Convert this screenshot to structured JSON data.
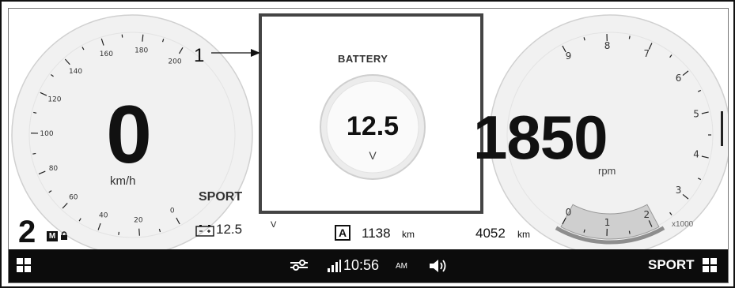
{
  "callout": {
    "number": "1"
  },
  "battery": {
    "title": "BATTERY",
    "value": "12.5",
    "unit": "V"
  },
  "speedometer": {
    "value": "0",
    "unit": "km/h",
    "ticks": [
      "0",
      "20",
      "40",
      "60",
      "80",
      "100",
      "120",
      "140",
      "160",
      "180",
      "200"
    ]
  },
  "tachometer": {
    "value": "1850",
    "unit": "rpm",
    "multiplier": "x1000",
    "ticks": [
      "0",
      "1",
      "2",
      "3",
      "4",
      "5",
      "6",
      "7",
      "8",
      "9"
    ]
  },
  "riding_mode": {
    "label": "SPORT"
  },
  "gear": {
    "number": "2",
    "mode": "M"
  },
  "status": {
    "battery_value": "12.5",
    "battery_unit": "V",
    "trip_badge": "A",
    "trip_value": "1138",
    "trip_unit": "km",
    "odometer_value": "4052",
    "odometer_unit": "km"
  },
  "bottom_bar": {
    "time": "10:56",
    "ampm": "AM",
    "mode": "SPORT"
  },
  "icons": {
    "lock": "lock-icon",
    "battery": "battery-icon",
    "grid": "grid-icon",
    "connection": "connection-icon",
    "signal": "signal-icon",
    "speaker": "speaker-icon"
  },
  "colors": {
    "rpm_zone_arc": "#9a9a9a",
    "rpm_low_zone": "#c8c8c8",
    "bottom_bar": "#0c0c0c"
  }
}
